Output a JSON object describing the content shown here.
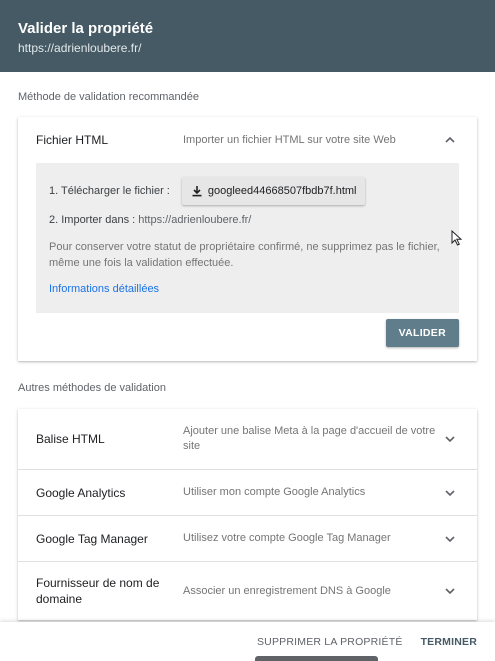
{
  "header": {
    "title": "Valider la propriété",
    "subtitle": "https://adrienloubere.fr/"
  },
  "recommended": {
    "section_label": "Méthode de validation recommandée",
    "method": {
      "name": "Fichier HTML",
      "description": "Importer un fichier HTML sur votre site Web",
      "chevron": "chevron-up-icon",
      "step1_label": "1. Télécharger le fichier :",
      "download_icon": "download-icon",
      "download_file": "googleed44668507fbdb7f.html",
      "step2_label": "2. Importer dans :",
      "step2_url": "https://adrienloubere.fr/",
      "note": "Pour conserver votre statut de propriétaire confirmé, ne supprimez pas le fichier, même une fois la validation effectuée.",
      "more_link": "Informations détaillées",
      "validate_label": "VALIDER"
    }
  },
  "others": {
    "section_label": "Autres méthodes de validation",
    "methods": [
      {
        "name": "Balise HTML",
        "description": "Ajouter une balise Meta à la page d'accueil de votre site",
        "chevron": "chevron-down-icon"
      },
      {
        "name": "Google Analytics",
        "description": "Utiliser mon compte Google Analytics",
        "chevron": "chevron-down-icon"
      },
      {
        "name": "Google Tag Manager",
        "description": "Utilisez votre compte Google Tag Manager",
        "chevron": "chevron-down-icon"
      },
      {
        "name": "Fournisseur de nom de domaine",
        "description": "Associer un enregistrement DNS à Google",
        "chevron": "chevron-down-icon"
      }
    ]
  },
  "footer": {
    "delete_label": "SUPPRIMER LA PROPRIÉTÉ",
    "done_label": "TERMINER"
  },
  "colors": {
    "header_bg": "#455a64",
    "validate_bg": "#607d8b",
    "link": "#1a73e8"
  }
}
